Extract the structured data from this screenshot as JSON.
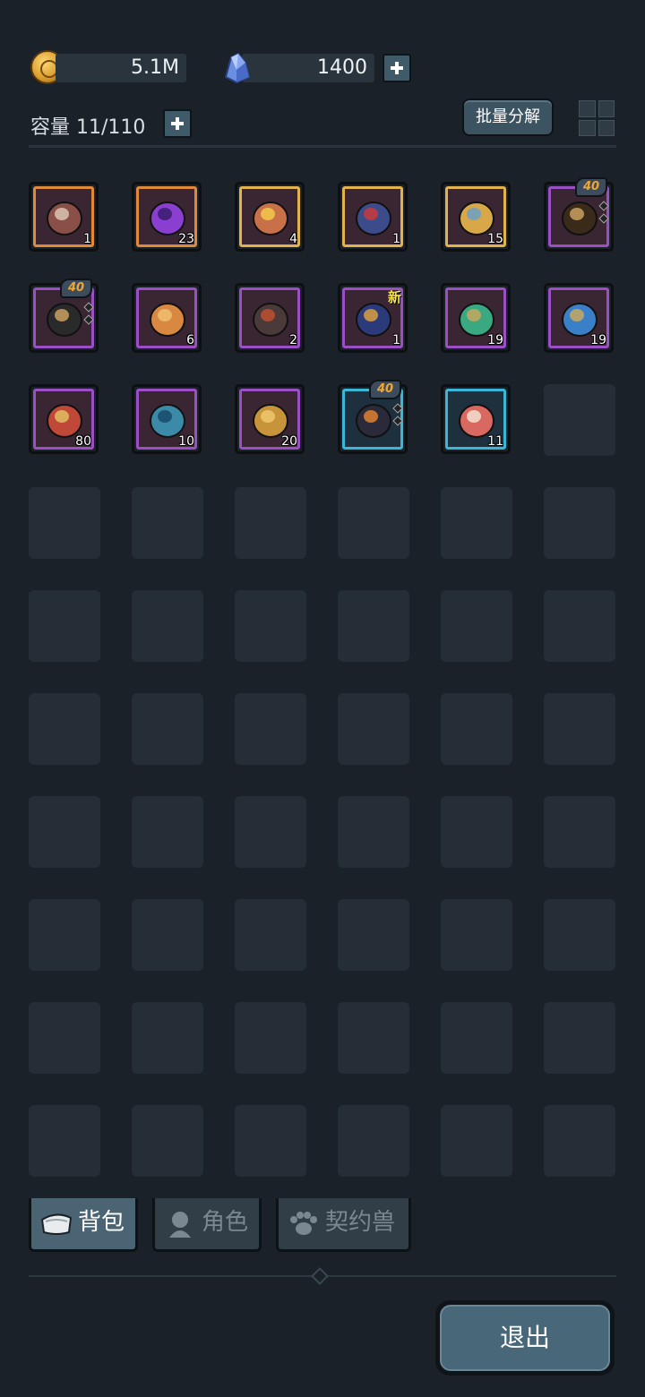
{
  "currency": {
    "gold": "5.1M",
    "crystals": "1400"
  },
  "capacity": {
    "label": "容量 11/110"
  },
  "bulk_decompose_label": "批量分解",
  "items": [
    {
      "name": "mushroom",
      "rarity": "orange",
      "count": "1"
    },
    {
      "name": "purple-rune-stone",
      "rarity": "orange",
      "count": "23"
    },
    {
      "name": "fire-seed-pouch",
      "rarity": "gold",
      "count": "4"
    },
    {
      "name": "demon-helmet-egg",
      "rarity": "gold",
      "count": "1"
    },
    {
      "name": "crossed-swords-token",
      "rarity": "gold",
      "count": "15"
    },
    {
      "name": "spiked-club",
      "rarity": "purple",
      "count": "",
      "level": "40"
    },
    {
      "name": "spiked-amulet",
      "rarity": "purple",
      "count": "",
      "level": "40"
    },
    {
      "name": "bread",
      "rarity": "purple",
      "count": "6"
    },
    {
      "name": "dark-potion",
      "rarity": "purple",
      "count": "2"
    },
    {
      "name": "blue-potion",
      "rarity": "purple",
      "count": "1",
      "new": "新"
    },
    {
      "name": "green-claw-charm",
      "rarity": "purple",
      "count": "19"
    },
    {
      "name": "blue-claw-charm",
      "rarity": "purple",
      "count": "19"
    },
    {
      "name": "red-elixir",
      "rarity": "purple",
      "count": "80"
    },
    {
      "name": "treasure-map",
      "rarity": "purple",
      "count": "10"
    },
    {
      "name": "golden-key",
      "rarity": "purple",
      "count": "20"
    },
    {
      "name": "dark-helmet",
      "rarity": "cyan",
      "count": "",
      "level": "40"
    },
    {
      "name": "ham",
      "rarity": "cyan",
      "count": "11"
    }
  ],
  "tabs": {
    "bag": "背包",
    "role": "角色",
    "pet": "契约兽"
  },
  "exit_label": "退出",
  "colors": {
    "background": "#1a2128",
    "orange": "#e08938",
    "gold": "#e2b24d",
    "purple": "#9a4fc4",
    "cyan": "#3ab7d6",
    "level_text": "#f0a633",
    "new_text": "#f6e34a"
  }
}
